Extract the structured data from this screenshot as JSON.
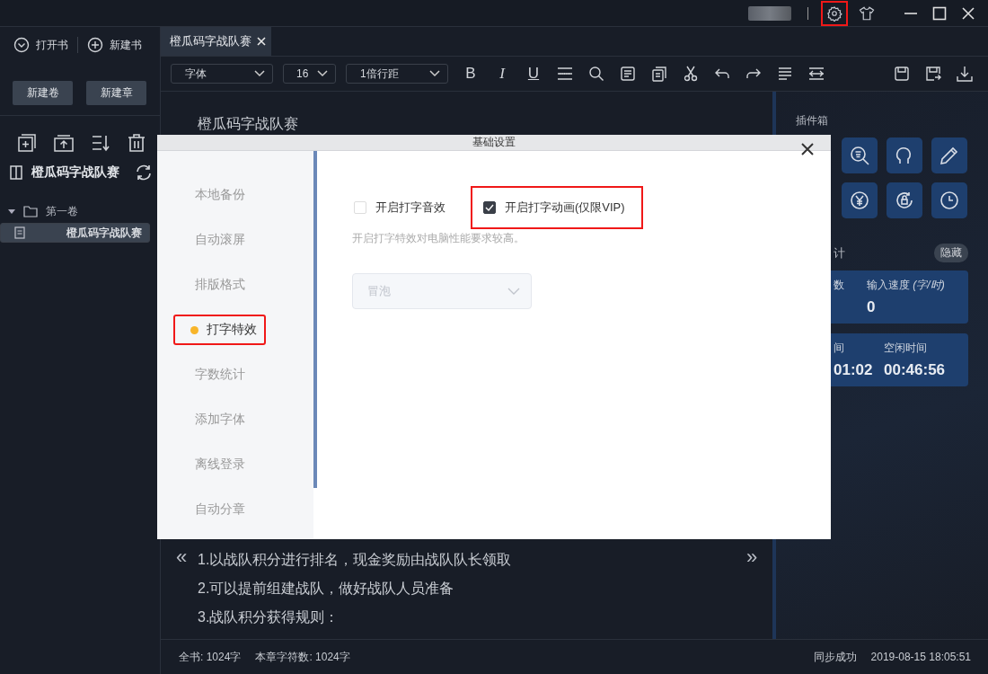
{
  "title_bar": {
    "settings_highlighted": true
  },
  "sidebar": {
    "actions": [
      {
        "kind": "open",
        "label": "打开书"
      },
      {
        "kind": "new",
        "label": "新建书"
      }
    ],
    "buttons": [
      "新建卷",
      "新建章"
    ],
    "book_title": "橙瓜码字战队赛",
    "tree": [
      {
        "label": "第一卷",
        "expanded": true,
        "children": [
          {
            "label": "橙瓜码字战队赛",
            "selected": true
          }
        ]
      }
    ]
  },
  "tabs": [
    {
      "label": "橙瓜码字战队赛",
      "selected": true
    }
  ],
  "toolbar": {
    "font": "字体",
    "size": "16",
    "spacing": "1倍行距",
    "format_buttons": [
      "B",
      "I",
      "U"
    ]
  },
  "editor": {
    "title": "橙瓜码字战队赛",
    "lines": [
      "1.以战队积分进行排名，现金奖励由战队队长领取",
      "2.可以提前组建战队，做好战队人员准备",
      "3.战队积分获得规则："
    ],
    "prev": "«",
    "next": "»"
  },
  "right_panel": {
    "title": "插件箱",
    "section_label": "计",
    "hide_button": "隐藏",
    "stat_cards": [
      [
        {
          "label": "数"
        },
        {
          "label": "输入速度 *(字/时)*",
          "value": "0"
        }
      ],
      [
        {
          "label": "间",
          "value": "01:02"
        },
        {
          "label": "空闲时间",
          "value": "00:46:56"
        }
      ]
    ]
  },
  "status_bar": {
    "book_count": "全书: 1024字",
    "chapter_count": "本章字符数: 1024字",
    "sync": "同步成功",
    "time": "2019-08-15 18:05:51"
  },
  "dialog": {
    "title": "基础设置",
    "nav": [
      {
        "label": "本地备份",
        "selected": false,
        "highlighted": false
      },
      {
        "label": "自动滚屏",
        "selected": false,
        "highlighted": false
      },
      {
        "label": "排版格式",
        "selected": false,
        "highlighted": false
      },
      {
        "label": "打字特效",
        "selected": true,
        "highlighted": true
      },
      {
        "label": "字数统计",
        "selected": false,
        "highlighted": false
      },
      {
        "label": "添加字体",
        "selected": false,
        "highlighted": false
      },
      {
        "label": "离线登录",
        "selected": false,
        "highlighted": false
      },
      {
        "label": "自动分章",
        "selected": false,
        "highlighted": false
      }
    ],
    "options": [
      {
        "label": "开启打字音效",
        "checked": false,
        "highlighted": false
      },
      {
        "label": "开启打字动画(仅限VIP)",
        "checked": true,
        "highlighted": true
      }
    ],
    "hint": "开启打字特效对电脑性能要求较高。",
    "select": {
      "value": "冒泡",
      "disabled": true
    }
  }
}
